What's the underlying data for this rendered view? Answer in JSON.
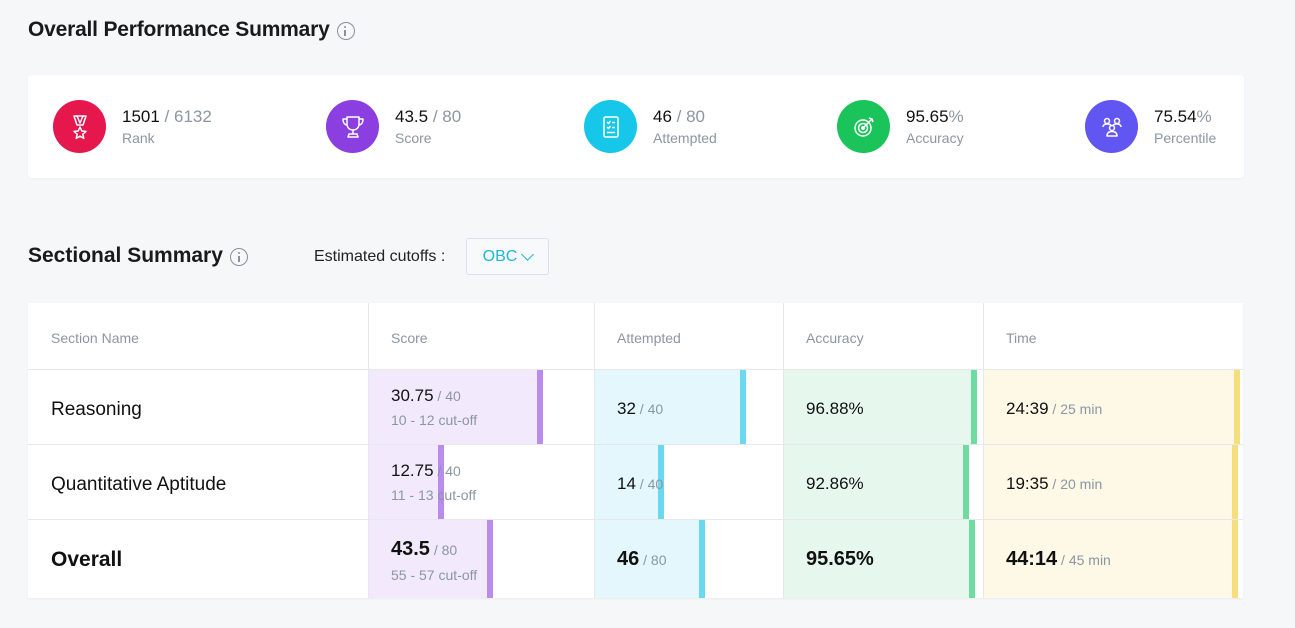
{
  "overall": {
    "title": "Overall Performance Summary",
    "stats": [
      {
        "main": "1501",
        "sub": " / 6132",
        "label": "Rank",
        "color": "#e6174d",
        "icon": "medal-icon"
      },
      {
        "main": "43.5",
        "sub": " / 80",
        "label": "Score",
        "color": "#8b3fe0",
        "icon": "trophy-icon"
      },
      {
        "main": "46",
        "sub": " / 80",
        "label": "Attempted",
        "color": "#16c7ea",
        "icon": "checklist-icon"
      },
      {
        "main": "95.65",
        "sub": "%",
        "label": "Accuracy",
        "color": "#1bc45a",
        "icon": "target-icon"
      },
      {
        "main": "75.54",
        "sub": "%",
        "label": "Percentile",
        "color": "#6256f2",
        "icon": "people-icon"
      }
    ]
  },
  "sectional": {
    "title": "Sectional Summary",
    "cutoff_label": "Estimated cutoffs :",
    "cutoff_value": "OBC",
    "headers": [
      "Section Name",
      "Score",
      "Attempted",
      "Accuracy",
      "Time"
    ],
    "colors": {
      "score": "#b98bed",
      "attempted": "#6ad8ef",
      "accuracy": "#6edca0",
      "time": "#f6de7c"
    },
    "rows": [
      {
        "name": "Reasoning",
        "score": "30.75",
        "score_max": " / 40",
        "cutoff": "10 - 12 cut-off",
        "score_frac": 0.77,
        "attempted": "32",
        "attempted_max": " / 40",
        "attempted_frac": 0.8,
        "accuracy": "96.88%",
        "accuracy_frac": 0.97,
        "time": "24:39",
        "time_max": " / 25 min",
        "time_frac": 0.99
      },
      {
        "name": "Quantitative Aptitude",
        "score": "12.75",
        "score_max": " / 40",
        "cutoff": "11 - 13 cut-off",
        "score_frac": 0.32,
        "attempted": "14",
        "attempted_max": " / 40",
        "attempted_frac": 0.35,
        "accuracy": "92.86%",
        "accuracy_frac": 0.93,
        "time": "19:35",
        "time_max": " / 20 min",
        "time_frac": 0.98
      },
      {
        "name": "Overall",
        "score": "43.5",
        "score_max": " / 80",
        "cutoff": "55 - 57 cut-off",
        "score_frac": 0.54,
        "attempted": "46",
        "attempted_max": " / 80",
        "attempted_frac": 0.575,
        "accuracy": "95.65%",
        "accuracy_frac": 0.96,
        "time": "44:14",
        "time_max": " / 45 min",
        "time_frac": 0.98
      }
    ]
  }
}
